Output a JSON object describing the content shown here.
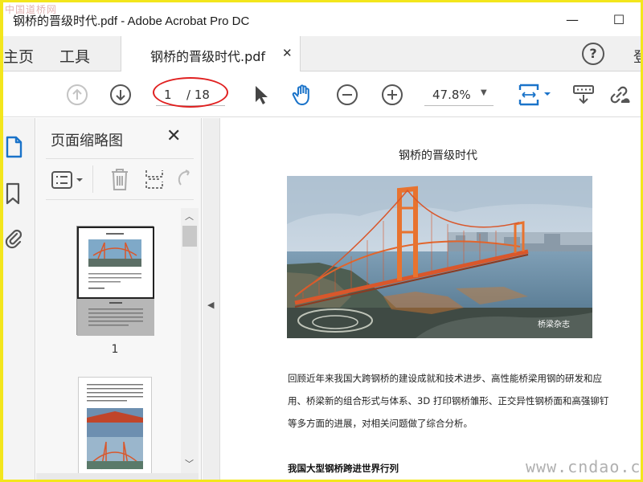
{
  "watermark_top": "中国道桥网",
  "window": {
    "title": "钢桥的晋级时代.pdf - Adobe Acrobat Pro DC",
    "minimize_glyph": "—",
    "maximize_glyph": "☐"
  },
  "menu": {
    "home": "主页",
    "tools": "工具",
    "login": "登"
  },
  "doc_tab": {
    "label": "钢桥的晋级时代.pdf",
    "close_glyph": "✕"
  },
  "help_glyph": "?",
  "toolbar": {
    "current_page": "1",
    "total_pages": "/ 18",
    "zoom": "47.8%",
    "icons": [
      "up-arrow-icon",
      "down-arrow-icon",
      "pointer-icon",
      "hand-icon",
      "zoom-out-icon",
      "zoom-in-icon",
      "fit-width-icon",
      "keyboard-icon",
      "link-icon"
    ]
  },
  "thumb_panel": {
    "title": "页面缩略图",
    "close_glyph": "✕",
    "page_number": "1"
  },
  "document": {
    "title": "钢桥的晋级时代",
    "image_watermark": "桥梁杂志",
    "para_line1": "回顾近年来我国大跨钢桥的建设成就和技术进步、高性能桥梁用钢的研发和应",
    "para_line2": "用、桥梁新的组合形式与体系、3D 打印钢桥雏形、正交异性钢桥面和高强铆钉",
    "para_line3": "等多方面的进展，对相关问题做了综合分析。",
    "heading": "我国大型钢桥跨进世界行列"
  },
  "site_watermark": "www.cndao.com",
  "colors": {
    "accent_blue": "#1a73c9",
    "annotation_red": "#e02020",
    "frame_yellow": "#f3e61c"
  }
}
